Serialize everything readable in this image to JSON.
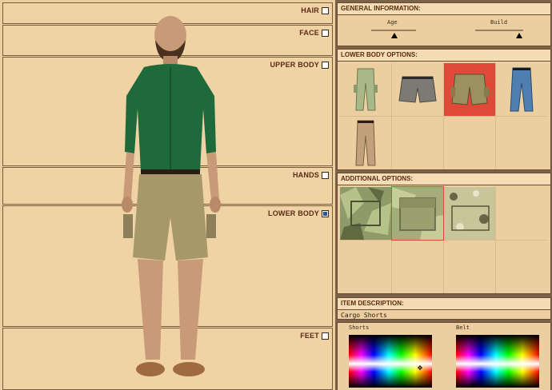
{
  "body_parts": [
    {
      "label": "HAIR",
      "checked": false
    },
    {
      "label": "FACE",
      "checked": false
    },
    {
      "label": "UPPER BODY",
      "checked": false
    },
    {
      "label": "HANDS",
      "checked": false
    },
    {
      "label": "LOWER BODY",
      "checked": true
    },
    {
      "label": "FEET",
      "checked": false
    }
  ],
  "general": {
    "title": "GENERAL INFORMATION:",
    "age_label": "Age",
    "build_label": "Build"
  },
  "lower_body": {
    "title": "LOWER BODY OPTIONS:",
    "items": [
      {
        "icon": "green-cargo-pants-icon",
        "color": "#a9b889",
        "selected": false
      },
      {
        "icon": "grey-shorts-icon",
        "color": "#7d7a74",
        "selected": false
      },
      {
        "icon": "olive-cargo-shorts-icon",
        "color": "#9a9060",
        "selected": true
      },
      {
        "icon": "blue-jeans-icon",
        "color": "#4f7fb0",
        "selected": false
      },
      {
        "icon": "khaki-trousers-icon",
        "color": "#c2a07c",
        "selected": false
      }
    ]
  },
  "additional": {
    "title": "ADDITIONAL OPTIONS:",
    "items": [
      {
        "icon": "grass-camo-pattern-icon",
        "selected": false
      },
      {
        "icon": "pocket-camo-pattern-icon",
        "selected": true
      },
      {
        "icon": "stone-camo-pattern-icon",
        "selected": false
      }
    ]
  },
  "description": {
    "title": "ITEM DESCRIPTION:",
    "text": "Cargo Shorts"
  },
  "palettes": {
    "shorts_label": "Shorts",
    "belt_label": "Belt"
  },
  "colors": {
    "shirt": "#1f6a3a",
    "shorts": "#a69868",
    "skin": "#c89a78",
    "selected_cell": "#e04838"
  }
}
